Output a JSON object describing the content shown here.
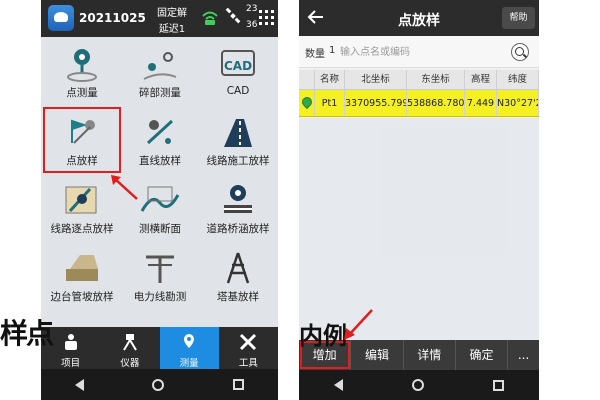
{
  "left_phone": {
    "status": {
      "date": "20211025",
      "fix": "固定解",
      "delay": "延迟1",
      "sat_top": "23",
      "sat_bottom": "36"
    },
    "menu": [
      {
        "label": "点测量",
        "icon": "point-survey-icon"
      },
      {
        "label": "碎部测量",
        "icon": "detail-survey-icon"
      },
      {
        "label": "CAD",
        "icon": "cad-icon"
      },
      {
        "label": "点放样",
        "icon": "point-stakeout-icon",
        "selected": true
      },
      {
        "label": "直线放样",
        "icon": "line-stakeout-icon"
      },
      {
        "label": "线路施工放样",
        "icon": "route-construction-icon"
      },
      {
        "label": "线路逐点放样",
        "icon": "route-point-icon"
      },
      {
        "label": "测横断面",
        "icon": "cross-section-icon"
      },
      {
        "label": "道路桥涵放样",
        "icon": "bridge-stakeout-icon"
      },
      {
        "label": "边台管坡放样",
        "icon": "slope-stakeout-icon"
      },
      {
        "label": "电力线勘测",
        "icon": "power-line-icon"
      },
      {
        "label": "塔基放样",
        "icon": "tower-icon"
      }
    ],
    "tabs": [
      {
        "label": "项目",
        "icon": "project-icon"
      },
      {
        "label": "仪器",
        "icon": "instrument-icon"
      },
      {
        "label": "测量",
        "icon": "survey-icon",
        "active": true
      },
      {
        "label": "工具",
        "icon": "tools-icon"
      }
    ],
    "overlay_text": "样点"
  },
  "right_phone": {
    "title": "点放样",
    "help": "帮助",
    "search": {
      "count_label": "数量",
      "count_value": "1",
      "placeholder": "输入点名或编码"
    },
    "table": {
      "headers": [
        "",
        "名称",
        "北坐标",
        "东坐标",
        "高程",
        "纬度"
      ],
      "rows": [
        [
          "",
          "Pt1",
          "3370955.799",
          "538868.780",
          "7.449",
          "N30°27'28.8"
        ]
      ]
    },
    "bottom_buttons": [
      "增加",
      "编辑",
      "详情",
      "确定",
      "..."
    ],
    "overlay_text": "内例"
  },
  "colors": {
    "accent_blue": "#1e8ce0",
    "highlight_yellow": "#f4f022",
    "annotation_red": "#e21d1d",
    "icon_teal": "#1f6f7a"
  }
}
